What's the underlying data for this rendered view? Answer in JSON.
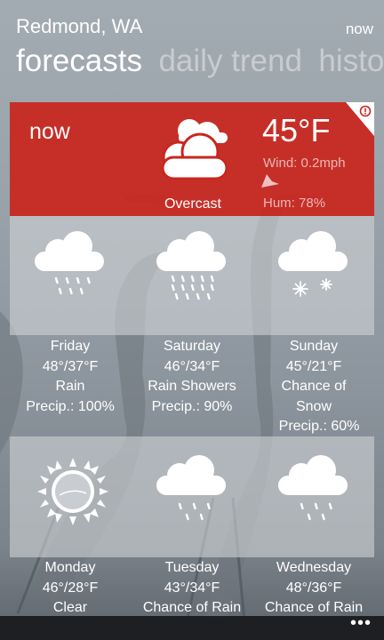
{
  "header": {
    "location": "Redmond, WA",
    "now_link": "now",
    "pivot": [
      "forecasts",
      "daily trend",
      "histo"
    ]
  },
  "current": {
    "label": "now",
    "condition": "Overcast",
    "temperature": "45°F",
    "wind": "Wind: 0.2mph",
    "humidity": "Hum: 78%",
    "icon": "overcast-cloud-icon",
    "card_color": "#c9261e"
  },
  "forecast": [
    {
      "day": "Friday",
      "temps": "48°/37°F",
      "condition": "Rain",
      "condition_2": "",
      "precip": "Precip.: 100%",
      "icon": "rain-cloud-icon"
    },
    {
      "day": "Saturday",
      "temps": "46°/34°F",
      "condition": "Rain Showers",
      "condition_2": "",
      "precip": "Precip.: 90%",
      "icon": "rain-showers-cloud-icon"
    },
    {
      "day": "Sunday",
      "temps": "45°/21°F",
      "condition": "Chance of",
      "condition_2": "Snow",
      "precip": "Precip.: 60%",
      "icon": "snow-cloud-icon"
    },
    {
      "day": "Monday",
      "temps": "46°/28°F",
      "condition": "Clear",
      "icon": "sun-icon"
    },
    {
      "day": "Tuesday",
      "temps": "43°/34°F",
      "condition": "Chance of Rain",
      "icon": "chance-rain-cloud-icon"
    },
    {
      "day": "Wednesday",
      "temps": "48°/36°F",
      "condition": "Chance of Rain",
      "icon": "chance-rain-cloud-icon"
    }
  ],
  "app_bar": {
    "more": "•••"
  }
}
